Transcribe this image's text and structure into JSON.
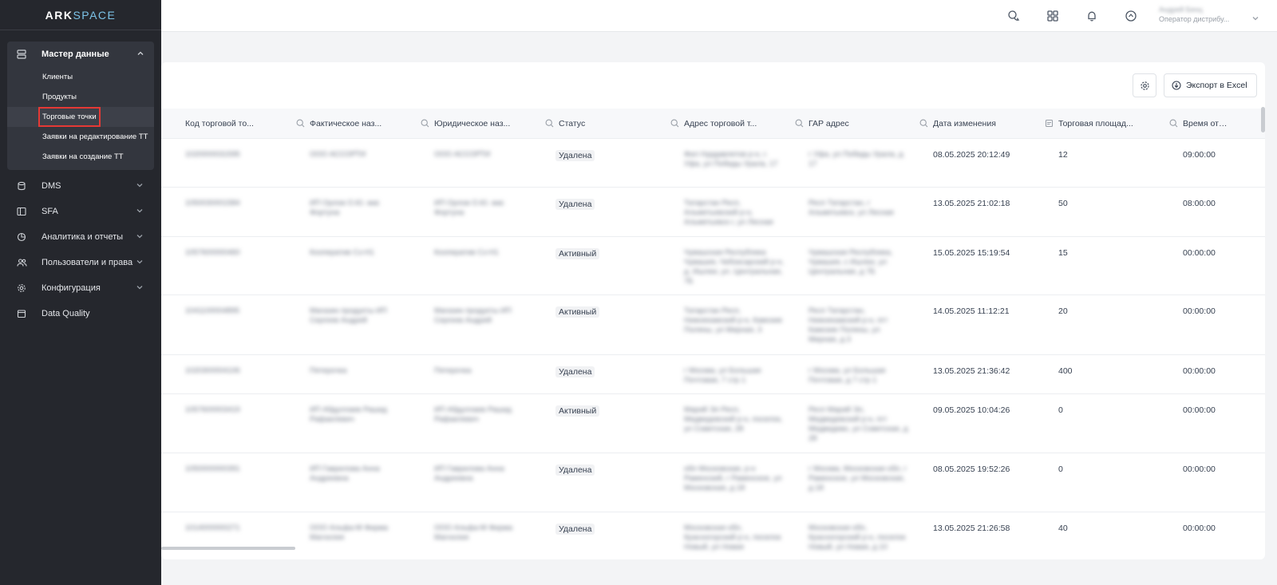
{
  "app": {
    "logo_part1": "ARK",
    "logo_part2": "SPACE"
  },
  "sidebar": {
    "master": {
      "label": "Мастер данные",
      "items": [
        {
          "label": "Клиенты",
          "active": false
        },
        {
          "label": "Продукты",
          "active": false
        },
        {
          "label": "Торговые точки",
          "active": true
        },
        {
          "label": "Заявки на редактирование ТТ",
          "active": false
        },
        {
          "label": "Заявки на создание ТТ",
          "active": false
        }
      ]
    },
    "items": [
      {
        "label": "DMS",
        "icon": "database-icon"
      },
      {
        "label": "SFA",
        "icon": "layout-icon"
      },
      {
        "label": "Аналитика и отчеты",
        "icon": "pie-chart-icon"
      },
      {
        "label": "Пользователи и права",
        "icon": "users-icon"
      },
      {
        "label": "Конфигурация",
        "icon": "gear-icon"
      },
      {
        "label": "Data Quality",
        "icon": "calendar-icon"
      }
    ]
  },
  "header": {
    "user_name": "Андрей Бенц",
    "user_role": "Оператор дистрибу..."
  },
  "toolbar": {
    "export_label": "Экспорт в Excel"
  },
  "table": {
    "columns": [
      "Код торговой то...",
      "Фактическое наз...",
      "Юридическое наз...",
      "Статус",
      "Адрес торговой т...",
      "ГАР адрес",
      "Дата изменения",
      "Торговая площад...",
      "Время открытия"
    ],
    "rows": [
      {
        "code": "1020000031595",
        "fact": "ООО АССОРТИ",
        "legal": "ООО АССОРТИ",
        "status": "Удалена",
        "address": "Фил Нурдавлетов р-н, г. Уфа, ул Победы Урала, 17",
        "gar": "г Уфа, ул Победы Урала, д 17",
        "date": "08.05.2025 20:12:49",
        "area": "12",
        "open": "09:00:00"
      },
      {
        "code": "1050030001584",
        "fact": "ИП Орлов О.Ю. маг. Фортуна",
        "legal": "ИП Орлов О.Ю. маг. Фортуна",
        "status": "Удалена",
        "address": "Татарстан Респ, Альметьевский р-н, Альметьевск г, ул Лесная",
        "gar": "Респ Татарстан, г Альметьевск, ул Лесная",
        "date": "13.05.2025 21:02:18",
        "area": "50",
        "open": "08:00:00"
      },
      {
        "code": "1057600000460",
        "fact": "Кооператив Сз-Н1",
        "legal": "Кооператив Сз-Н1",
        "status": "Активный",
        "address": "Чувашская Республика Чувашия, Чебоксарский р-н, д. Ишлеи, ул. Центральная, 7Б",
        "gar": "Чувашская Республика, Чувашия, с Ишлеи, ул Центральная, д 7Б",
        "date": "15.05.2025 15:19:54",
        "area": "15",
        "open": "00:00:00"
      },
      {
        "code": "1041100004895",
        "fact": "Магазин продукты ИП Сергеев Андрей",
        "legal": "Магазин продукты ИП Сергеев Андрей",
        "status": "Активный",
        "address": "Татарстан Респ, Нижнекамский р-н, Камские Поляны, ул Мирная, 3",
        "gar": "Респ Татарстан, Нижнекамский р-н, пгт Камские Поляны, ул Мирная, д 3",
        "date": "14.05.2025 11:12:21",
        "area": "20",
        "open": "00:00:00"
      },
      {
        "code": "1020300004106",
        "fact": "Пятерочка",
        "legal": "Пятерочка",
        "status": "Удалена",
        "address": "г Москва, ул Большая Почтовая, 7 стр 1",
        "gar": "г Москва, ул Большая Почтовая, д 7 стр 1",
        "date": "13.05.2025 21:36:42",
        "area": "400",
        "open": "00:00:00"
      },
      {
        "code": "1057600003419",
        "fact": "ИП Абдуллаев Рашид Рафаилевич",
        "legal": "ИП Абдуллаев Рашид Рафаилевич",
        "status": "Активный",
        "address": "Марий Эл Респ, Медведевский р-н, поселок, ул Советская, 28",
        "gar": "Респ Марий Эл, Медведевский р-н, пгт Медведево, ул Советская, д 28",
        "date": "09.05.2025 10:04:26",
        "area": "0",
        "open": "00:00:00"
      },
      {
        "code": "1050000000391",
        "fact": "ИП Гаврилова Анна Андреевна",
        "legal": "ИП Гаврилова Анна Андреевна",
        "status": "Удалена",
        "address": "обл Московская, р-н Раменский, г Раменское, ул Московская, д 18",
        "gar": "г Москва, Московская обл, г Раменское, ул Московская, д 18",
        "date": "08.05.2025 19:52:26",
        "area": "0",
        "open": "00:00:00"
      },
      {
        "code": "1014000000271",
        "fact": "ООО Альфа-М Фирма Магнолия",
        "legal": "ООО Альфа-М Фирма Магнолия",
        "status": "Удалена",
        "address": "Московская обл, Красногорский р-н, поселок Новый, ул Новая",
        "gar": "Московская обл, Красногорский р-н, поселок Новый, ул Новая, д 10",
        "date": "13.05.2025 21:26:58",
        "area": "40",
        "open": "00:00:00"
      }
    ]
  }
}
